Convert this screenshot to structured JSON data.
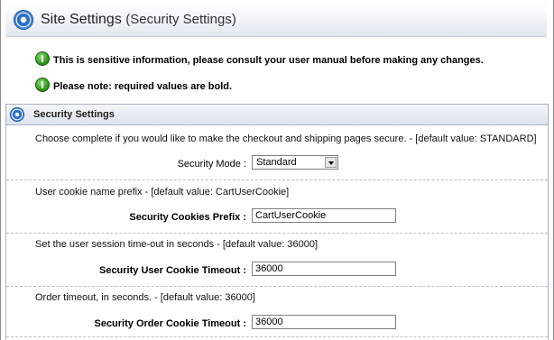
{
  "header": {
    "title": "Site Settings",
    "subtitle": "(Security Settings)",
    "icon": "gear-icon"
  },
  "notices": [
    {
      "text": "This is sensitive information, please consult your user manual before making any changes.",
      "icon": "info-icon"
    },
    {
      "text": "Please note: required values are bold.",
      "icon": "info-icon"
    }
  ],
  "section": {
    "title": "Security Settings",
    "icon": "gear-icon"
  },
  "fields": {
    "security_mode": {
      "description": "Choose complete if you would like to make the checkout and shipping pages secure. - [default value: STANDARD]",
      "label": "Security Mode :",
      "value": "Standard"
    },
    "cookies_prefix": {
      "description": "User cookie name prefix - [default value: CartUserCookie]",
      "label": "Security Cookies Prefix :",
      "value": "CartUserCookie"
    },
    "user_cookie_timeout": {
      "description": "Set the user session time-out in seconds - [default value: 36000]",
      "label": "Security User Cookie Timeout :",
      "value": "36000"
    },
    "order_cookie_timeout": {
      "description": "Order timeout, in seconds. - [default value: 36000]",
      "label": "Security Order Cookie Timeout :",
      "value": "36000"
    }
  },
  "colors": {
    "accent": "#2a6fc9",
    "notice_icon": "#2f9a1d"
  }
}
